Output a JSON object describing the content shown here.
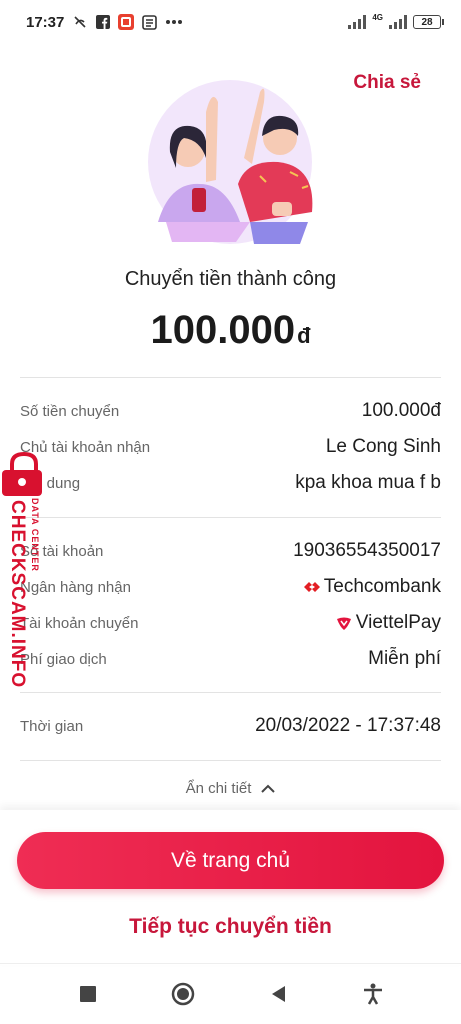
{
  "status_bar": {
    "time": "17:37",
    "icons": [
      "no-call-icon",
      "facebook-icon",
      "app-icon",
      "news-icon",
      "more-icon"
    ],
    "network": "4G",
    "battery": "28"
  },
  "header": {
    "share_label": "Chia sẻ"
  },
  "result": {
    "title": "Chuyển tiền thành công",
    "amount": "100.000",
    "currency": "đ"
  },
  "details": {
    "group1": [
      {
        "label": "Số tiền chuyển",
        "value": "100.000đ"
      },
      {
        "label": "Chủ tài khoản nhận",
        "value": "Le Cong Sinh"
      },
      {
        "label": "Nội dung",
        "value": "kpa khoa mua f b"
      }
    ],
    "group2": [
      {
        "label": "Số tài khoản",
        "value": "19036554350017"
      },
      {
        "label": "Ngân hàng nhận",
        "value": "Techcombank"
      },
      {
        "label": "Tài khoản chuyển",
        "value": "ViettelPay"
      },
      {
        "label": "Phí giao dịch",
        "value": "Miễn phí"
      }
    ],
    "time": {
      "label": "Thời gian",
      "value": "20/03/2022 - 17:37:48"
    }
  },
  "hide_detail_label": "Ẩn chi tiết",
  "actions": {
    "home_label": "Về trang chủ",
    "continue_label": "Tiếp tục chuyển tiền"
  },
  "watermark": {
    "main": "CHECKSCAM.INFO",
    "sub": "DATA CENTER"
  },
  "colors": {
    "accent": "#e3143e",
    "brand_text": "#c7173b"
  }
}
